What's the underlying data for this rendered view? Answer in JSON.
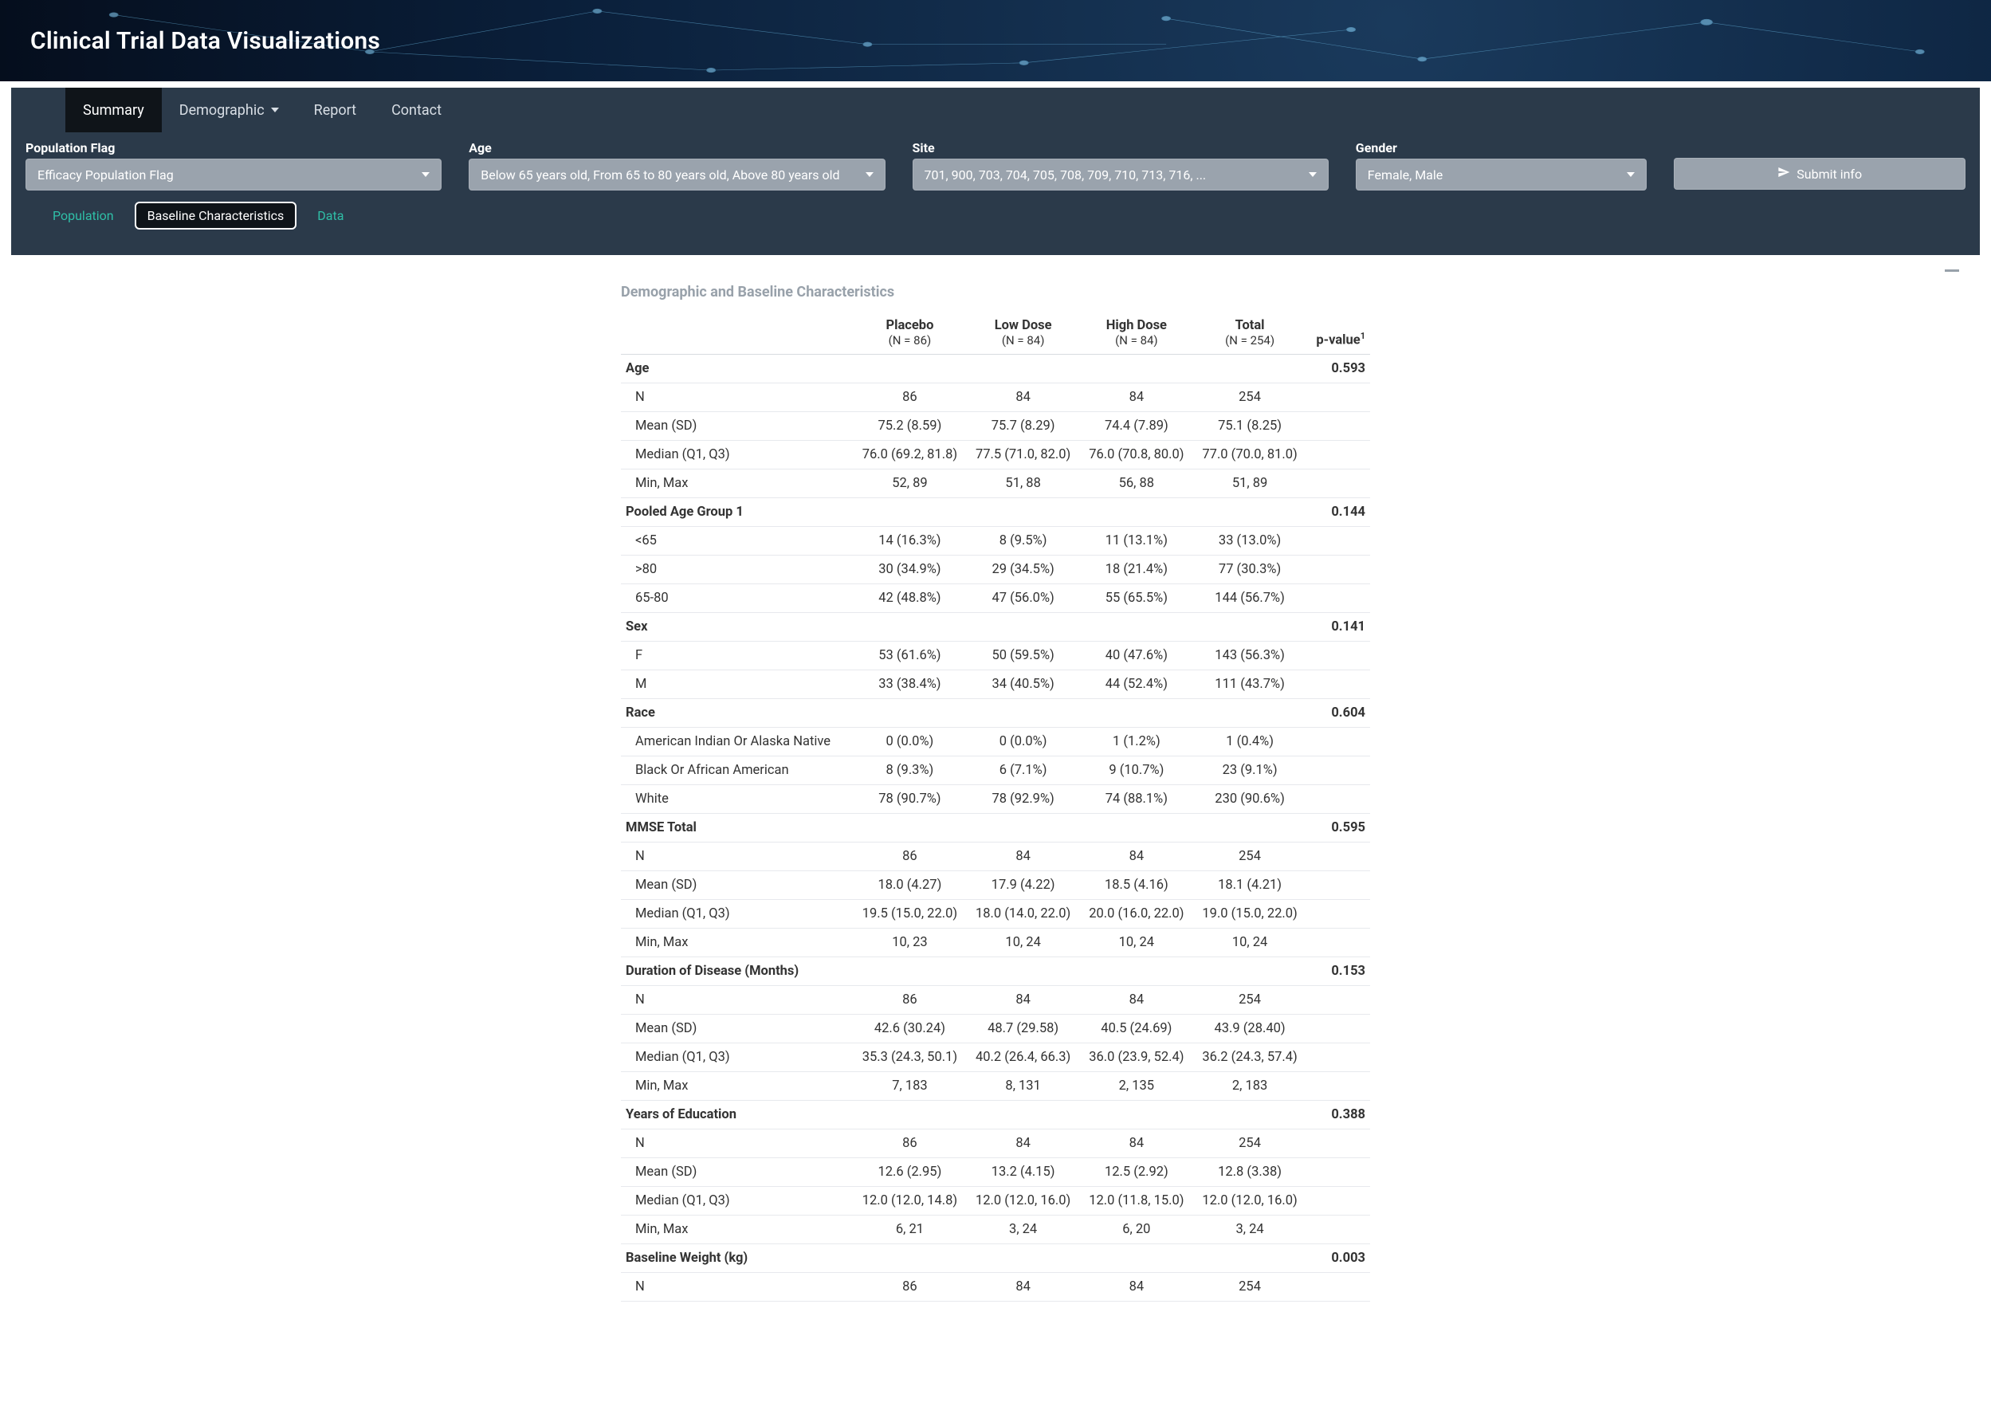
{
  "header": {
    "title": "Clinical Trial Data Visualizations"
  },
  "nav": {
    "items": [
      {
        "label": "Summary",
        "active": true
      },
      {
        "label": "Demographic",
        "caret": true
      },
      {
        "label": "Report"
      },
      {
        "label": "Contact"
      }
    ]
  },
  "filters": {
    "population": {
      "label": "Population Flag",
      "value": "Efficacy Population Flag"
    },
    "age": {
      "label": "Age",
      "value": "Below 65 years old, From 65 to 80 years old, Above 80 years old"
    },
    "site": {
      "label": "Site",
      "value": "701, 900, 703, 704, 705, 708, 709, 710, 713, 716, ..."
    },
    "gender": {
      "label": "Gender",
      "value": "Female, Male"
    },
    "submit": {
      "label": "Submit info"
    }
  },
  "subtabs": [
    {
      "label": "Population",
      "active": false
    },
    {
      "label": "Baseline Characteristics",
      "active": true
    },
    {
      "label": "Data",
      "active": false
    }
  ],
  "report": {
    "title": "Demographic and Baseline Characteristics",
    "columns": [
      {
        "head": "",
        "sub": ""
      },
      {
        "head": "Placebo",
        "sub": "(N = 86)"
      },
      {
        "head": "Low Dose",
        "sub": "(N = 84)"
      },
      {
        "head": "High Dose",
        "sub": "(N = 84)"
      },
      {
        "head": "Total",
        "sub": "(N = 254)"
      },
      {
        "head": "p-value",
        "sub": ""
      }
    ],
    "sections": [
      {
        "title": "Age",
        "pvalue": "0.593",
        "rows": [
          {
            "label": "N",
            "cells": [
              "86",
              "84",
              "84",
              "254"
            ]
          },
          {
            "label": "Mean (SD)",
            "cells": [
              "75.2 (8.59)",
              "75.7 (8.29)",
              "74.4 (7.89)",
              "75.1 (8.25)"
            ]
          },
          {
            "label": "Median (Q1, Q3)",
            "cells": [
              "76.0 (69.2, 81.8)",
              "77.5 (71.0, 82.0)",
              "76.0 (70.8, 80.0)",
              "77.0 (70.0, 81.0)"
            ]
          },
          {
            "label": "Min, Max",
            "cells": [
              "52, 89",
              "51, 88",
              "56, 88",
              "51, 89"
            ]
          }
        ]
      },
      {
        "title": "Pooled Age Group 1",
        "pvalue": "0.144",
        "rows": [
          {
            "label": "<65",
            "cells": [
              "14 (16.3%)",
              "8 (9.5%)",
              "11 (13.1%)",
              "33 (13.0%)"
            ]
          },
          {
            "label": ">80",
            "cells": [
              "30 (34.9%)",
              "29 (34.5%)",
              "18 (21.4%)",
              "77 (30.3%)"
            ]
          },
          {
            "label": "65-80",
            "cells": [
              "42 (48.8%)",
              "47 (56.0%)",
              "55 (65.5%)",
              "144 (56.7%)"
            ]
          }
        ]
      },
      {
        "title": "Sex",
        "pvalue": "0.141",
        "rows": [
          {
            "label": "F",
            "cells": [
              "53 (61.6%)",
              "50 (59.5%)",
              "40 (47.6%)",
              "143 (56.3%)"
            ]
          },
          {
            "label": "M",
            "cells": [
              "33 (38.4%)",
              "34 (40.5%)",
              "44 (52.4%)",
              "111 (43.7%)"
            ]
          }
        ]
      },
      {
        "title": "Race",
        "pvalue": "0.604",
        "rows": [
          {
            "label": "American Indian Or Alaska Native",
            "cells": [
              "0 (0.0%)",
              "0 (0.0%)",
              "1 (1.2%)",
              "1 (0.4%)"
            ]
          },
          {
            "label": "Black Or African American",
            "cells": [
              "8 (9.3%)",
              "6 (7.1%)",
              "9 (10.7%)",
              "23 (9.1%)"
            ]
          },
          {
            "label": "White",
            "cells": [
              "78 (90.7%)",
              "78 (92.9%)",
              "74 (88.1%)",
              "230 (90.6%)"
            ]
          }
        ]
      },
      {
        "title": "MMSE Total",
        "pvalue": "0.595",
        "rows": [
          {
            "label": "N",
            "cells": [
              "86",
              "84",
              "84",
              "254"
            ]
          },
          {
            "label": "Mean (SD)",
            "cells": [
              "18.0 (4.27)",
              "17.9 (4.22)",
              "18.5 (4.16)",
              "18.1 (4.21)"
            ]
          },
          {
            "label": "Median (Q1, Q3)",
            "cells": [
              "19.5 (15.0, 22.0)",
              "18.0 (14.0, 22.0)",
              "20.0 (16.0, 22.0)",
              "19.0 (15.0, 22.0)"
            ]
          },
          {
            "label": "Min, Max",
            "cells": [
              "10, 23",
              "10, 24",
              "10, 24",
              "10, 24"
            ]
          }
        ]
      },
      {
        "title": "Duration of Disease (Months)",
        "pvalue": "0.153",
        "rows": [
          {
            "label": "N",
            "cells": [
              "86",
              "84",
              "84",
              "254"
            ]
          },
          {
            "label": "Mean (SD)",
            "cells": [
              "42.6 (30.24)",
              "48.7 (29.58)",
              "40.5 (24.69)",
              "43.9 (28.40)"
            ]
          },
          {
            "label": "Median (Q1, Q3)",
            "cells": [
              "35.3 (24.3, 50.1)",
              "40.2 (26.4, 66.3)",
              "36.0 (23.9, 52.4)",
              "36.2 (24.3, 57.4)"
            ]
          },
          {
            "label": "Min, Max",
            "cells": [
              "7, 183",
              "8, 131",
              "2, 135",
              "2, 183"
            ]
          }
        ]
      },
      {
        "title": "Years of Education",
        "pvalue": "0.388",
        "rows": [
          {
            "label": "N",
            "cells": [
              "86",
              "84",
              "84",
              "254"
            ]
          },
          {
            "label": "Mean (SD)",
            "cells": [
              "12.6 (2.95)",
              "13.2 (4.15)",
              "12.5 (2.92)",
              "12.8 (3.38)"
            ]
          },
          {
            "label": "Median (Q1, Q3)",
            "cells": [
              "12.0 (12.0, 14.8)",
              "12.0 (12.0, 16.0)",
              "12.0 (11.8, 15.0)",
              "12.0 (12.0, 16.0)"
            ]
          },
          {
            "label": "Min, Max",
            "cells": [
              "6, 21",
              "3, 24",
              "6, 20",
              "3, 24"
            ]
          }
        ]
      },
      {
        "title": "Baseline Weight (kg)",
        "pvalue": "0.003",
        "rows": [
          {
            "label": "N",
            "cells": [
              "86",
              "84",
              "84",
              "254"
            ]
          }
        ]
      }
    ]
  }
}
